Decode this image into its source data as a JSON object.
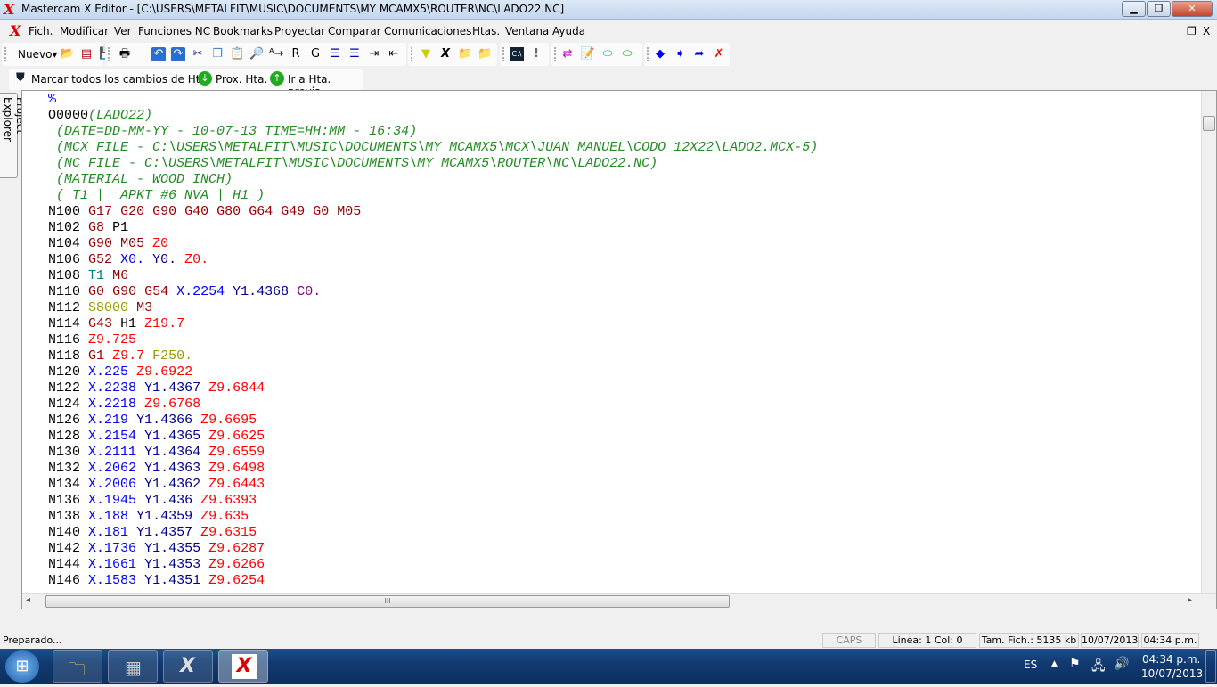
{
  "window": {
    "title": "Mastercam X Editor - [C:\\USERS\\METALFIT\\MUSIC\\DOCUMENTS\\MY MCAMX5\\ROUTER\\NC\\LADO22.NC]",
    "minimize": "▁",
    "maximize": "❐",
    "close": "✕"
  },
  "menu": {
    "items": [
      "Fich.",
      "Modificar",
      "Ver",
      "Funciones NC",
      "Bookmarks",
      "Proyectar",
      "Comparar",
      "Comunicaciones",
      "Htas.",
      "Ventana",
      "Ayuda"
    ],
    "mdi_min": "_",
    "mdi_restore": "❐",
    "mdi_close": "X"
  },
  "toolbar": {
    "new_label": "Nuevo"
  },
  "toolbar2": {
    "mark_all": "Marcar todos los cambios de Hta.",
    "next_tool": "Prox. Hta.",
    "prev_tool": "Ir a Hta. previa"
  },
  "sidebar": {
    "project_explorer": "Project Explorer"
  },
  "editor": {
    "lines": [
      "%",
      "O0000(LADO22)",
      "(DATE=DD-MM-YY - 10-07-13 TIME=HH:MM - 16:34)",
      "(MCX FILE - C:\\USERS\\METALFIT\\MUSIC\\DOCUMENTS\\MY MCAMX5\\MCX\\JUAN MANUEL\\CODO 12X22\\LADO2.MCX-5)",
      "(NC FILE - C:\\USERS\\METALFIT\\MUSIC\\DOCUMENTS\\MY MCAMX5\\ROUTER\\NC\\LADO22.NC)",
      "(MATERIAL - WOOD INCH)",
      "( T1 |  APKT #6 NVA | H1 )",
      "N100 G17 G20 G90 G40 G80 G64 G49 G0 M05",
      "N102 G8 P1",
      "N104 G90 M05 Z0",
      "N106 G52 X0. Y0. Z0.",
      "N108 T1 M6",
      "N110 G0 G90 G54 X.2254 Y1.4368 C0.",
      "N112 S8000 M3",
      "N114 G43 H1 Z19.7",
      "N116 Z9.725",
      "N118 G1 Z9.7 F250.",
      "N120 X.225 Z9.6922",
      "N122 X.2238 Y1.4367 Z9.6844",
      "N124 X.2218 Z9.6768",
      "N126 X.219 Y1.4366 Z9.6695",
      "N128 X.2154 Y1.4365 Z9.6625",
      "N130 X.2111 Y1.4364 Z9.6559",
      "N132 X.2062 Y1.4363 Z9.6498",
      "N134 X.2006 Y1.4362 Z9.6443",
      "N136 X.1945 Y1.436 Z9.6393",
      "N138 X.188 Y1.4359 Z9.635",
      "N140 X.181 Y1.4357 Z9.6315",
      "N142 X.1736 Y1.4355 Z9.6287",
      "N144 X.1661 Y1.4353 Z9.6266",
      "N146 X.1583 Y1.4351 Z9.6254"
    ],
    "hscroll_grip": "III"
  },
  "status": {
    "ready": "Preparado...",
    "caps": "CAPS",
    "line_col": "Linea:  1  Col:  0",
    "file_size": "Tam. Fich.: 5135 kb",
    "date": "10/07/2013",
    "time": "04:34 p.m."
  },
  "taskbar": {
    "lang": "ES",
    "clock_time": "04:34 p.m.",
    "clock_date": "10/07/2013"
  },
  "colors": {
    "comment": "#228b22",
    "g_code": "#990000",
    "x": "#0000ff",
    "y": "#00008b",
    "z": "#ff0000",
    "tool": "#008080",
    "speed_feed": "#999900",
    "c": "#800080"
  }
}
